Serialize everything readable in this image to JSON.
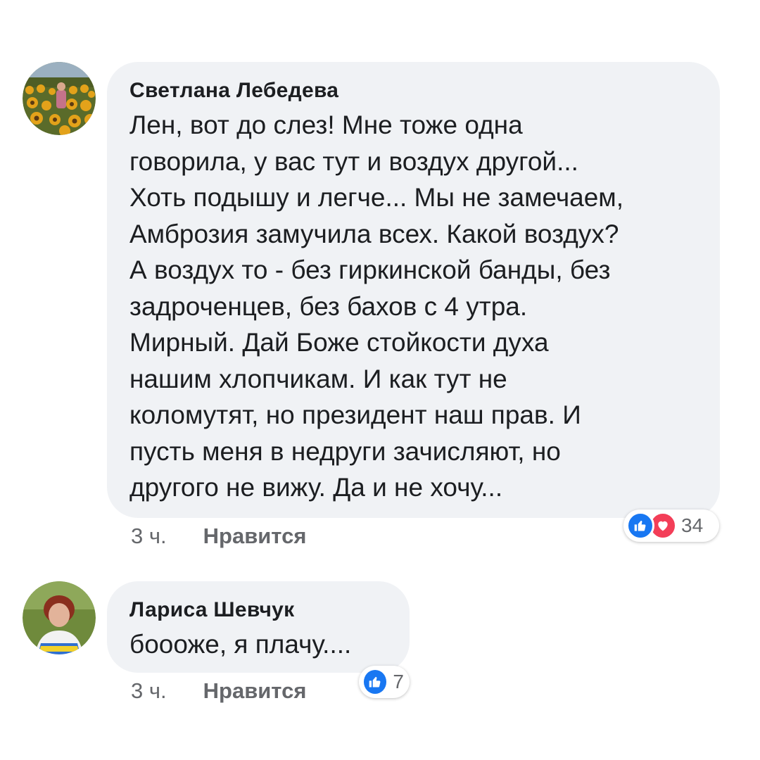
{
  "comments": [
    {
      "author": "Светлана Лебедева",
      "lines": [
        "Лен, вот до слез! Мне тоже одна",
        "говорила, у вас тут и воздух другой...",
        "Хоть подышу и легче... Мы не замечаем,",
        "Амброзия замучила всех. Какой воздух?",
        "А воздух то - без гиркинской банды, без",
        "задроченцев, без бахов с 4 утра.",
        "Мирный. Дай Боже стойкости духа",
        "нашим хлопчикам. И как тут не",
        "коломутят, но президент наш прав. И",
        "пусть меня в недруги зачисляют, но",
        "другого не вижу. Да и не хочу..."
      ],
      "time": "3 ч.",
      "like_label": "Нравится",
      "reaction_count": "34",
      "reactions": [
        "like-icon",
        "love-icon"
      ]
    },
    {
      "author": "Лариса Шевчук",
      "lines": [
        "боооже, я плачу...."
      ],
      "time": "3 ч.",
      "like_label": "Нравится",
      "reaction_count": "7",
      "reactions": [
        "like-icon"
      ]
    }
  ],
  "colors": {
    "bubble": "#f0f2f5",
    "like_blue": "#1877f2",
    "love_red": "#f33e58",
    "meta_gray": "#65676b"
  }
}
